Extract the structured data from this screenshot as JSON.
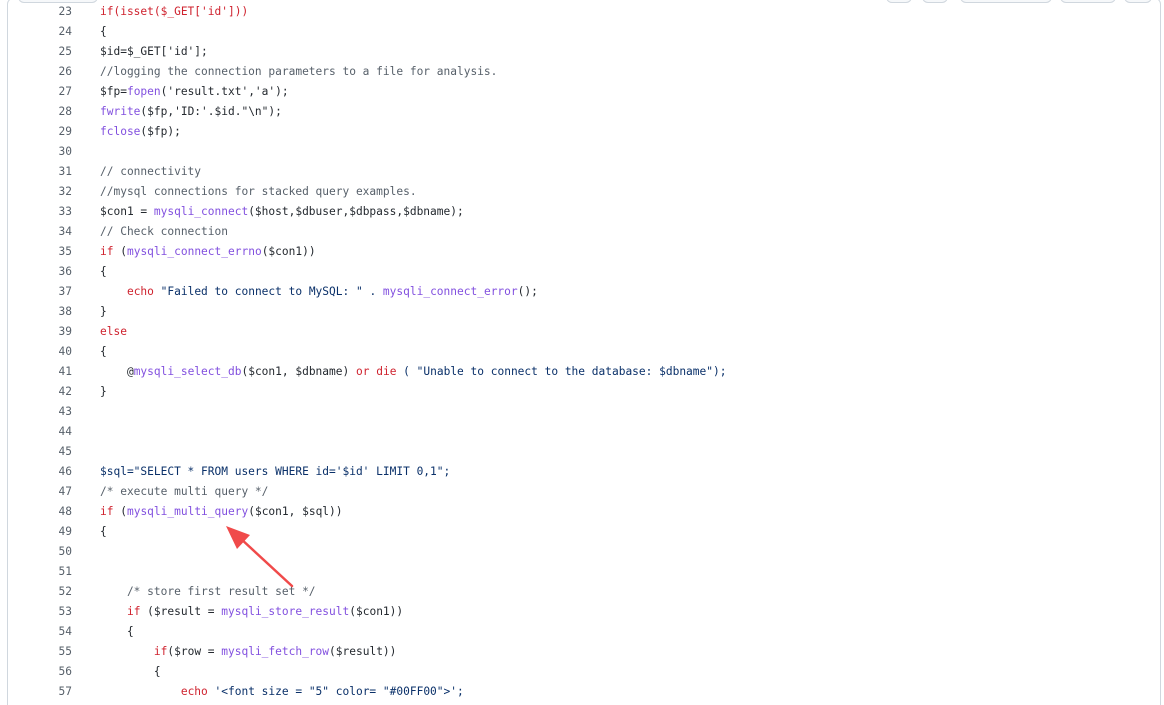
{
  "lines": [
    {
      "n": "23",
      "segs": [
        {
          "t": "if(isset($_GET['id']))",
          "c": "k"
        }
      ]
    },
    {
      "n": "24",
      "segs": [
        {
          "t": "{",
          "c": "t"
        }
      ]
    },
    {
      "n": "25",
      "segs": [
        {
          "t": "$id=$_GET['id'];",
          "c": "t"
        }
      ]
    },
    {
      "n": "26",
      "segs": [
        {
          "t": "//logging the connection parameters to a file for analysis.",
          "c": "c"
        }
      ]
    },
    {
      "n": "27",
      "segs": [
        {
          "t": "$fp=",
          "c": "t"
        },
        {
          "t": "fopen",
          "c": "f"
        },
        {
          "t": "('result.txt','a');",
          "c": "t"
        }
      ]
    },
    {
      "n": "28",
      "segs": [
        {
          "t": "fwrite",
          "c": "f"
        },
        {
          "t": "($fp,'ID:'.$id.\"\\n\");",
          "c": "t"
        }
      ]
    },
    {
      "n": "29",
      "segs": [
        {
          "t": "fclose",
          "c": "f"
        },
        {
          "t": "($fp);",
          "c": "t"
        }
      ]
    },
    {
      "n": "30",
      "segs": []
    },
    {
      "n": "31",
      "segs": [
        {
          "t": "// connectivity",
          "c": "c"
        }
      ]
    },
    {
      "n": "32",
      "segs": [
        {
          "t": "//mysql connections for stacked query examples.",
          "c": "c"
        }
      ]
    },
    {
      "n": "33",
      "segs": [
        {
          "t": "$con1 = ",
          "c": "t"
        },
        {
          "t": "mysqli_connect",
          "c": "f"
        },
        {
          "t": "($host,$dbuser,$dbpass,$dbname);",
          "c": "t"
        }
      ]
    },
    {
      "n": "34",
      "segs": [
        {
          "t": "// Check connection",
          "c": "c"
        }
      ]
    },
    {
      "n": "35",
      "segs": [
        {
          "t": "if",
          "c": "k"
        },
        {
          "t": " (",
          "c": "t"
        },
        {
          "t": "mysqli_connect_errno",
          "c": "f"
        },
        {
          "t": "($con1))",
          "c": "t"
        }
      ]
    },
    {
      "n": "36",
      "segs": [
        {
          "t": "{",
          "c": "t"
        }
      ]
    },
    {
      "n": "37",
      "segs": [
        {
          "t": "    ",
          "c": "t"
        },
        {
          "t": "echo",
          "c": "k"
        },
        {
          "t": " \"Failed to connect to MySQL: \" . ",
          "c": "s"
        },
        {
          "t": "mysqli_connect_error",
          "c": "f"
        },
        {
          "t": "();",
          "c": "t"
        }
      ]
    },
    {
      "n": "38",
      "segs": [
        {
          "t": "}",
          "c": "t"
        }
      ]
    },
    {
      "n": "39",
      "segs": [
        {
          "t": "else",
          "c": "k"
        }
      ]
    },
    {
      "n": "40",
      "segs": [
        {
          "t": "{",
          "c": "t"
        }
      ]
    },
    {
      "n": "41",
      "segs": [
        {
          "t": "    @",
          "c": "t"
        },
        {
          "t": "mysqli_select_db",
          "c": "f"
        },
        {
          "t": "($con1, $dbname) ",
          "c": "t"
        },
        {
          "t": "or",
          "c": "k"
        },
        {
          "t": " ",
          "c": "t"
        },
        {
          "t": "die",
          "c": "k"
        },
        {
          "t": " ( \"Unable to connect to the database: $dbname\");",
          "c": "s"
        }
      ]
    },
    {
      "n": "42",
      "segs": [
        {
          "t": "}",
          "c": "t"
        }
      ]
    },
    {
      "n": "43",
      "segs": []
    },
    {
      "n": "44",
      "segs": []
    },
    {
      "n": "45",
      "segs": []
    },
    {
      "n": "46",
      "segs": [
        {
          "t": "$sql=\"SELECT * FROM users WHERE id='$id' LIMIT 0,1\";",
          "c": "s"
        }
      ]
    },
    {
      "n": "47",
      "segs": [
        {
          "t": "/* execute multi query */",
          "c": "c"
        }
      ]
    },
    {
      "n": "48",
      "segs": [
        {
          "t": "if",
          "c": "k"
        },
        {
          "t": " (",
          "c": "t"
        },
        {
          "t": "mysqli_multi_query",
          "c": "f"
        },
        {
          "t": "($con1, $sql))",
          "c": "t"
        }
      ]
    },
    {
      "n": "49",
      "segs": [
        {
          "t": "{",
          "c": "t"
        }
      ]
    },
    {
      "n": "50",
      "segs": []
    },
    {
      "n": "51",
      "segs": []
    },
    {
      "n": "52",
      "segs": [
        {
          "t": "    /* store first result set */",
          "c": "c"
        }
      ]
    },
    {
      "n": "53",
      "segs": [
        {
          "t": "    ",
          "c": "t"
        },
        {
          "t": "if",
          "c": "k"
        },
        {
          "t": " ($result = ",
          "c": "t"
        },
        {
          "t": "mysqli_store_result",
          "c": "f"
        },
        {
          "t": "($con1))",
          "c": "t"
        }
      ]
    },
    {
      "n": "54",
      "segs": [
        {
          "t": "    {",
          "c": "t"
        }
      ]
    },
    {
      "n": "55",
      "segs": [
        {
          "t": "        ",
          "c": "t"
        },
        {
          "t": "if",
          "c": "k"
        },
        {
          "t": "($row = ",
          "c": "t"
        },
        {
          "t": "mysqli_fetch_row",
          "c": "f"
        },
        {
          "t": "($result))",
          "c": "t"
        }
      ]
    },
    {
      "n": "56",
      "segs": [
        {
          "t": "        {",
          "c": "t"
        }
      ]
    },
    {
      "n": "57",
      "segs": [
        {
          "t": "            ",
          "c": "t"
        },
        {
          "t": "echo",
          "c": "k"
        },
        {
          "t": " '<font size = \"5\" color= \"#00FF00\">';",
          "c": "s"
        }
      ]
    }
  ],
  "annotation": {
    "type": "arrow",
    "color": "#f04a4a",
    "target": "mysqli_multi_query"
  }
}
